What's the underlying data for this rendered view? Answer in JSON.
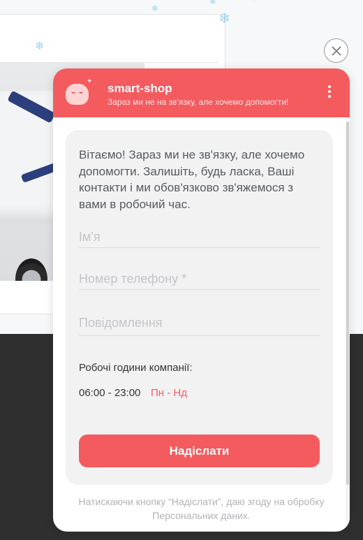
{
  "widget": {
    "title": "smart-shop",
    "subtitle": "Зараз ми не на зв'язку, але хочемо допомогти!",
    "accent_color": "#f35b5f",
    "greeting": "Вітаємо! Зараз ми не зв'язку, але хочемо допомогти. Залишіть, будь ласка, Ваші контакти і ми обов'язково зв'яжемося з вами в робочий час.",
    "fields": {
      "name_placeholder": "Ім'я",
      "phone_placeholder": "Номер телефону *",
      "message_placeholder": "Повідомлення"
    },
    "hours": {
      "label": "Робочі години компанії:",
      "time": "06:00 - 23:00",
      "days": "Пн - Нд"
    },
    "submit_label": "Надіслати",
    "consent_text": "Натискаючи кнопку “Надіслати”, даю згоду на обробку Персональних даних."
  },
  "icons": {
    "close": "close-icon",
    "menu": "kebab-menu-icon",
    "avatar": "sleeping-avatar-icon"
  }
}
